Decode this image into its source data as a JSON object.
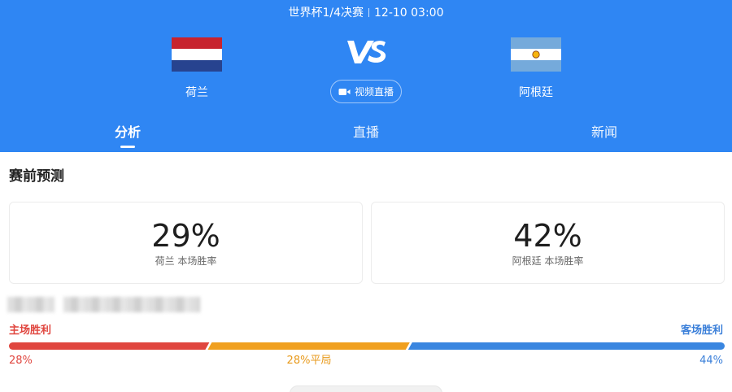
{
  "header": {
    "match_title": "世界杯1/4决赛",
    "match_time": "12-10 03:00",
    "home_team": {
      "name": "荷兰",
      "flag": "netherlands-flag"
    },
    "away_team": {
      "name": "阿根廷",
      "flag": "argentina-flag"
    },
    "vs_text": "VS",
    "video_button_label": "视频直播",
    "colors": {
      "header_bg": "#2f86f3"
    }
  },
  "tabs": [
    {
      "label": "分析",
      "active": true
    },
    {
      "label": "直播",
      "active": false
    },
    {
      "label": "新闻",
      "active": false
    }
  ],
  "prediction": {
    "title": "赛前预测",
    "home": {
      "value": "29%",
      "label": "荷兰 本场胜率"
    },
    "away": {
      "value": "42%",
      "label": "阿根廷 本场胜率"
    }
  },
  "odds": {
    "home_label": "主场胜利",
    "away_label": "客场胜利",
    "home_pct_text": "28%",
    "draw_pct_text": "28%平局",
    "away_pct_text": "44%",
    "home_share": 28,
    "draw_share": 28,
    "away_share": 44,
    "colors": {
      "home": "#e0463f",
      "draw": "#f0a020",
      "away": "#3a86e0"
    }
  }
}
